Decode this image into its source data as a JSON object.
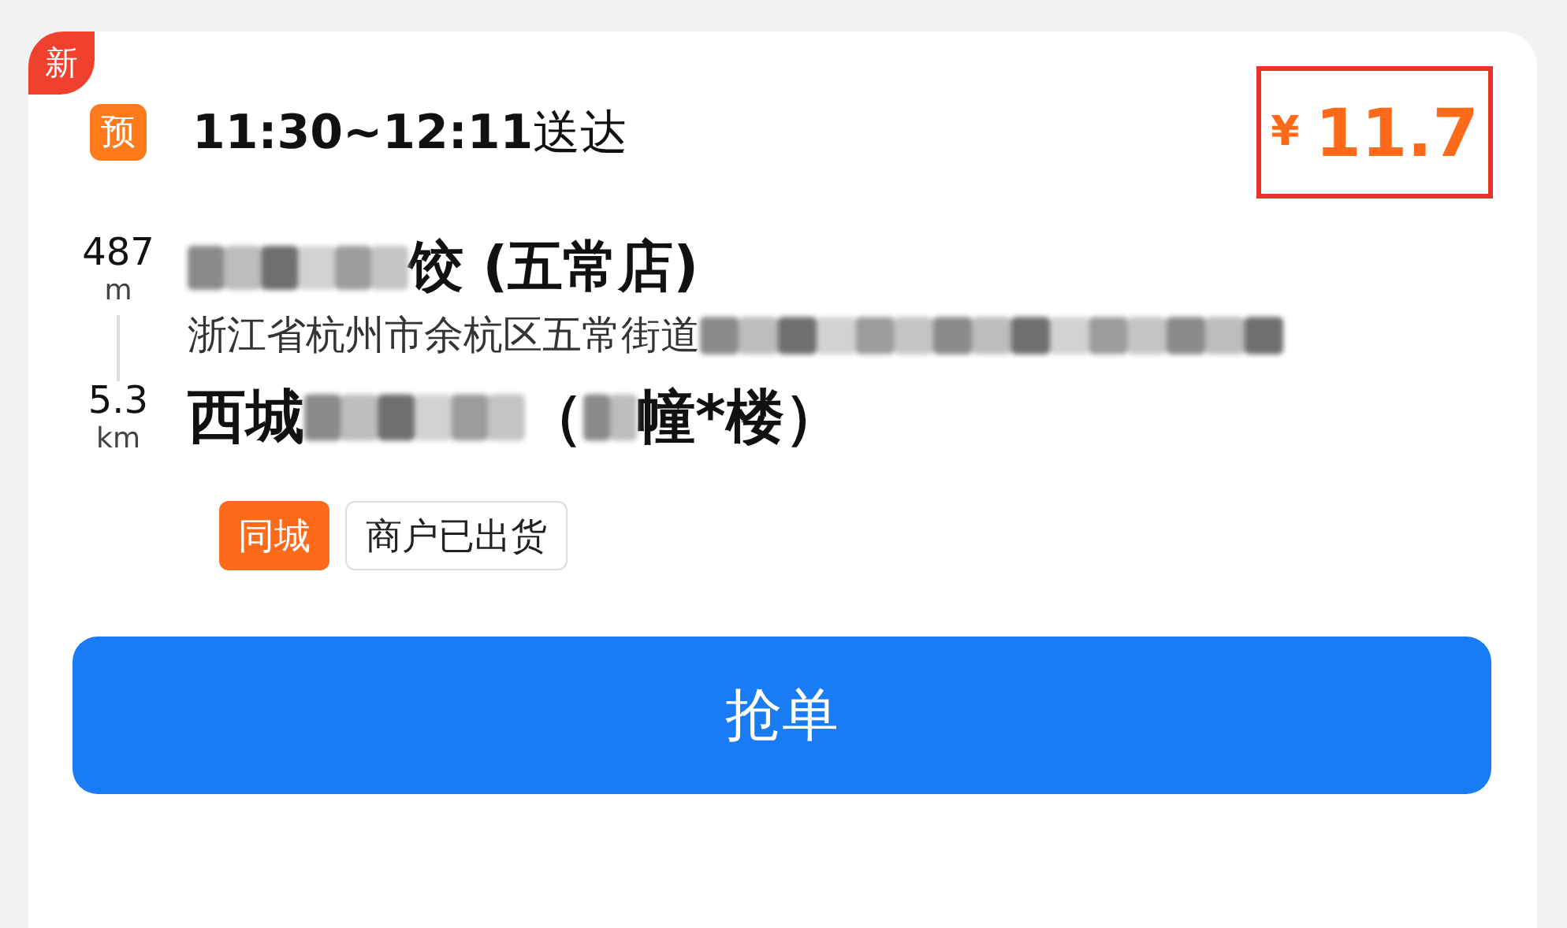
{
  "order": {
    "is_new": true,
    "new_badge": "新",
    "schedule_badge": "预",
    "time": "11:30~12:11",
    "time_suffix": "送达",
    "currency": "¥",
    "price": "11.7",
    "price_highlighted": true
  },
  "pickup": {
    "distance": "487",
    "unit": "m",
    "name_parts": [
      {
        "kind": "blur"
      },
      {
        "kind": "text",
        "text": "饺 (五常店)"
      }
    ],
    "address_parts": [
      {
        "kind": "text",
        "text": "浙江省杭州市余杭区五常街道"
      },
      {
        "kind": "blur_long"
      }
    ]
  },
  "dropoff": {
    "distance": "5.3",
    "unit": "km",
    "name_parts": [
      {
        "kind": "text",
        "text": "西城"
      },
      {
        "kind": "blur"
      },
      {
        "kind": "text",
        "text": "（"
      },
      {
        "kind": "blur_small"
      },
      {
        "kind": "text",
        "text": "幢*楼）"
      }
    ]
  },
  "tags": [
    {
      "kind": "filled",
      "text": "同城"
    },
    {
      "kind": "outline",
      "text": "商户已出货"
    }
  ],
  "action_button": "抢单"
}
